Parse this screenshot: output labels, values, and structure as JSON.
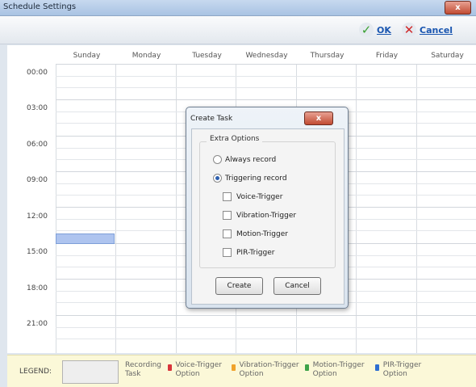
{
  "window": {
    "title": "Schedule Settings",
    "close_glyph": "x"
  },
  "toolbar": {
    "ok_label": "OK",
    "cancel_label": "Cancel"
  },
  "calendar": {
    "days": [
      "Sunday",
      "Monday",
      "Tuesday",
      "Wednesday",
      "Thursday",
      "Friday",
      "Saturday"
    ],
    "times": [
      "00:00",
      "03:00",
      "06:00",
      "09:00",
      "12:00",
      "15:00",
      "18:00",
      "21:00"
    ]
  },
  "legend": {
    "title": "LEGEND:",
    "items": [
      {
        "label": "Recording Task",
        "color": ""
      },
      {
        "label": "Voice-Trigger Option",
        "color": "#d9343a"
      },
      {
        "label": "Vibration-Trigger Option",
        "color": "#f0a32c"
      },
      {
        "label": "Motion-Trigger Option",
        "color": "#3ea34a"
      },
      {
        "label": "PIR-Trigger Option",
        "color": "#2f6fd1"
      }
    ]
  },
  "dialog": {
    "title": "Create Task",
    "group_title": "Extra Options",
    "always_record": "Always record",
    "triggering_record": "Triggering record",
    "triggers": [
      "Voice-Trigger",
      "Vibration-Trigger",
      "Motion-Trigger",
      "PIR-Trigger"
    ],
    "create_label": "Create",
    "cancel_label": "Cancel",
    "selected_mode": "Triggering record"
  }
}
